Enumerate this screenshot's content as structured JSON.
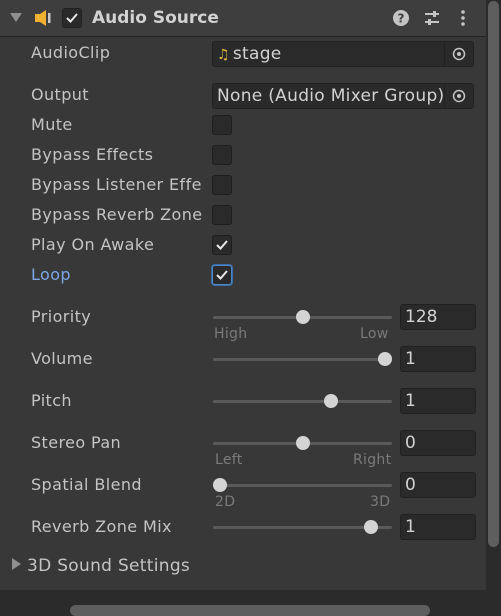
{
  "component": {
    "title": "Audio Source",
    "enabled": true
  },
  "header_icons": [
    "help-icon",
    "presets-icon",
    "kebab-menu-icon"
  ],
  "fields": {
    "audio_clip": {
      "label": "AudioClip",
      "value": "stage",
      "icon": "music-note-icon"
    },
    "output": {
      "label": "Output",
      "value": "None (Audio Mixer Group)"
    },
    "mute": {
      "label": "Mute",
      "checked": false
    },
    "bypass_effects": {
      "label": "Bypass Effects",
      "checked": false
    },
    "bypass_listener_effects": {
      "label": "Bypass Listener Effe",
      "checked": false
    },
    "bypass_reverb_zones": {
      "label": "Bypass Reverb Zone",
      "checked": false
    },
    "play_on_awake": {
      "label": "Play On Awake",
      "checked": true
    },
    "loop": {
      "label": "Loop",
      "checked": true
    }
  },
  "sliders": {
    "priority": {
      "label": "Priority",
      "value": "128",
      "fraction": 0.5,
      "min_label": "High",
      "max_label": "Low"
    },
    "volume": {
      "label": "Volume",
      "value": "1",
      "fraction": 1.0
    },
    "pitch": {
      "label": "Pitch",
      "value": "1",
      "fraction": 0.66
    },
    "stereo_pan": {
      "label": "Stereo Pan",
      "value": "0",
      "fraction": 0.5,
      "min_label": "Left",
      "max_label": "Right"
    },
    "spatial_blend": {
      "label": "Spatial Blend",
      "value": "0",
      "fraction": 0.0,
      "min_label": "2D",
      "max_label": "3D"
    },
    "reverb_zone_mix": {
      "label": "Reverb Zone Mix",
      "value": "1",
      "fraction": 0.91
    }
  },
  "sections": {
    "sound_3d": {
      "label": "3D Sound Settings",
      "expanded": false
    }
  },
  "colors": {
    "background": "#383838",
    "accent": "#7ba7e6",
    "music_icon": "#e0b53d",
    "speaker_icon": "#f0b030"
  }
}
